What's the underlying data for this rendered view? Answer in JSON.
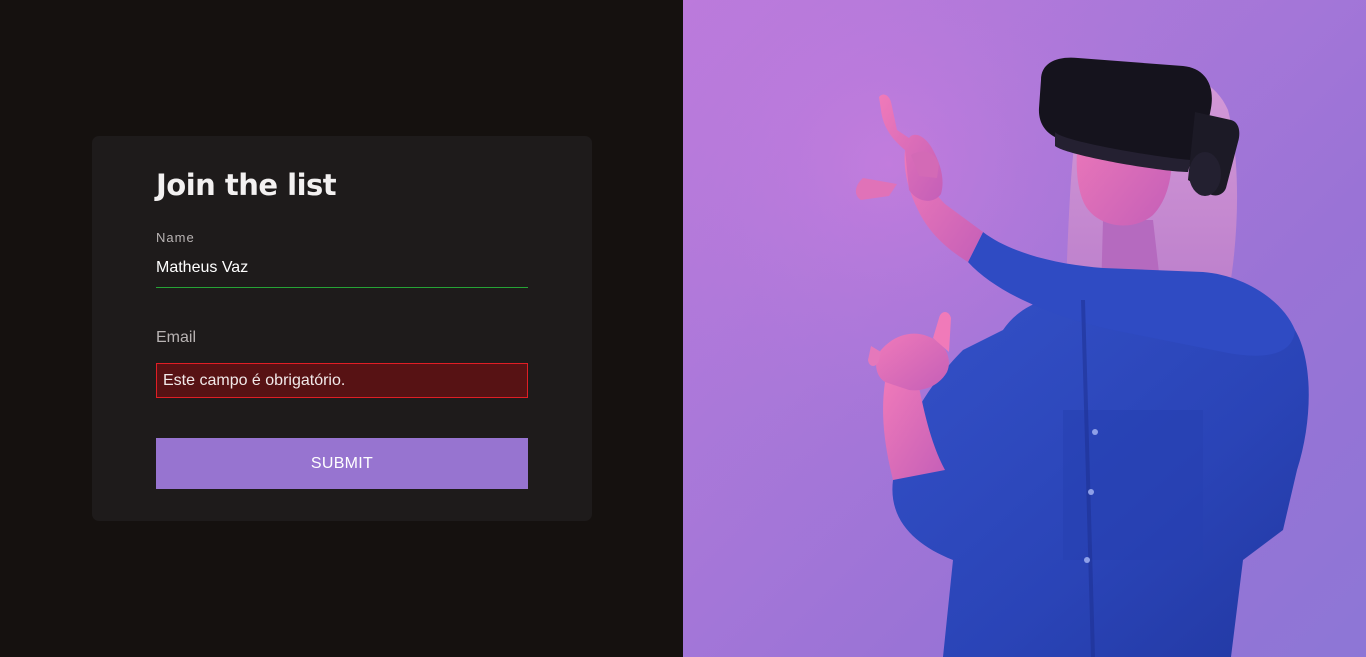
{
  "form": {
    "title": "Join the list",
    "name_label": "Name",
    "name_value": "Matheus Vaz",
    "email_label": "Email",
    "email_error_placeholder": "Este campo é obrigatório.",
    "submit_label": "SUBMIT"
  },
  "hero": {
    "subject": "woman wearing vr-headset"
  },
  "colors": {
    "left_background": "#15110f",
    "card_background": "#1e1b1b",
    "valid_underline": "#26a336",
    "error_background": "#571214",
    "error_border": "#e01e25",
    "submit_background": "#9774d0",
    "hero_background": "#b07bdb"
  }
}
